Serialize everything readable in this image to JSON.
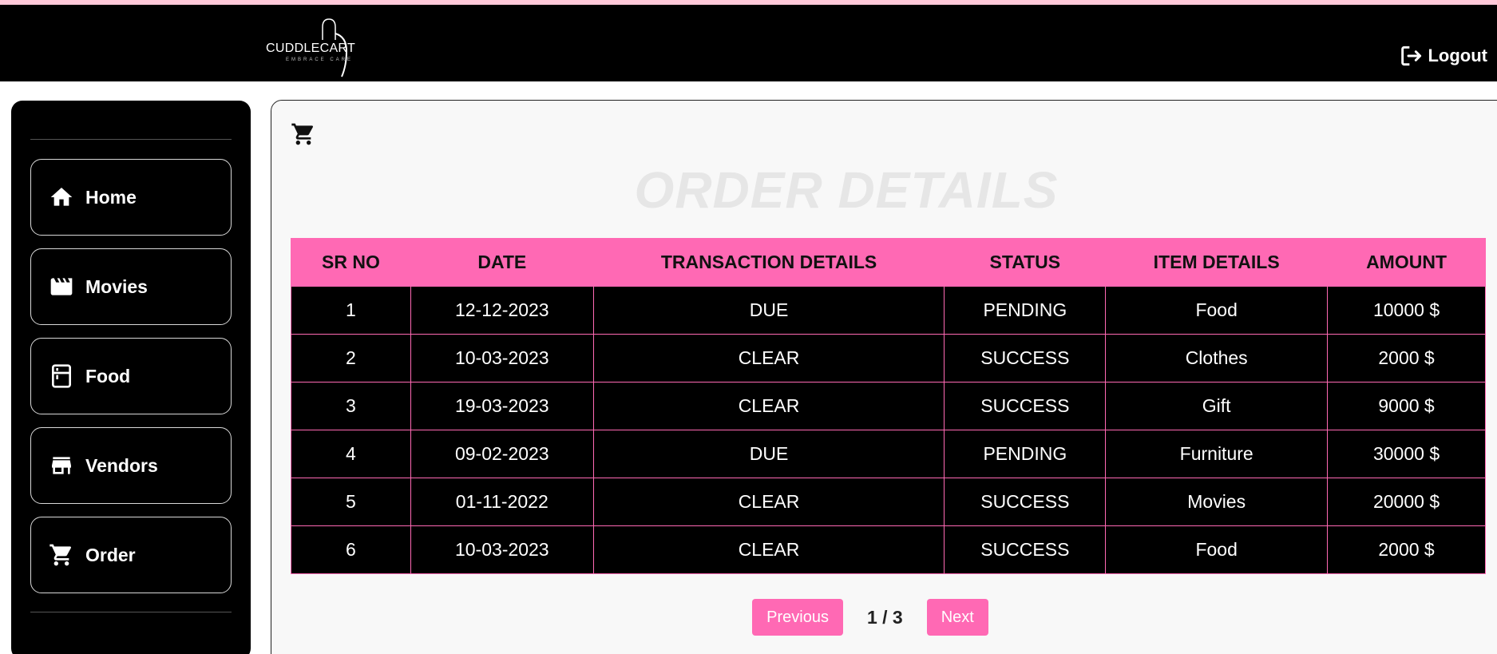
{
  "header": {
    "logo_text": "CUDDLECART",
    "logo_tagline": "EMBRACE CARE",
    "logout_label": "Logout"
  },
  "sidebar": {
    "items": [
      {
        "label": "Home",
        "icon": "home-icon"
      },
      {
        "label": "Movies",
        "icon": "movies-icon"
      },
      {
        "label": "Food",
        "icon": "food-icon"
      },
      {
        "label": "Vendors",
        "icon": "store-icon"
      },
      {
        "label": "Order",
        "icon": "cart-icon"
      }
    ]
  },
  "main": {
    "icon": "cart-icon",
    "title": "ORDER DETAILS",
    "table": {
      "headers": [
        "SR NO",
        "DATE",
        "TRANSACTION DETAILS",
        "STATUS",
        "ITEM DETAILS",
        "AMOUNT"
      ],
      "rows": [
        [
          "1",
          "12-12-2023",
          "DUE",
          "PENDING",
          "Food",
          "10000 $"
        ],
        [
          "2",
          "10-03-2023",
          "CLEAR",
          "SUCCESS",
          "Clothes",
          "2000 $"
        ],
        [
          "3",
          "19-03-2023",
          "CLEAR",
          "SUCCESS",
          "Gift",
          "9000 $"
        ],
        [
          "4",
          "09-02-2023",
          "DUE",
          "PENDING",
          "Furniture",
          "30000 $"
        ],
        [
          "5",
          "01-11-2022",
          "CLEAR",
          "SUCCESS",
          "Movies",
          "20000 $"
        ],
        [
          "6",
          "10-03-2023",
          "CLEAR",
          "SUCCESS",
          "Food",
          "2000 $"
        ]
      ]
    },
    "pagination": {
      "previous_label": "Previous",
      "page_info": "1 / 3",
      "next_label": "Next"
    }
  },
  "colors": {
    "accent": "#ff69b4",
    "header_bg": "#000000",
    "top_strip": "#ffc9d9"
  }
}
